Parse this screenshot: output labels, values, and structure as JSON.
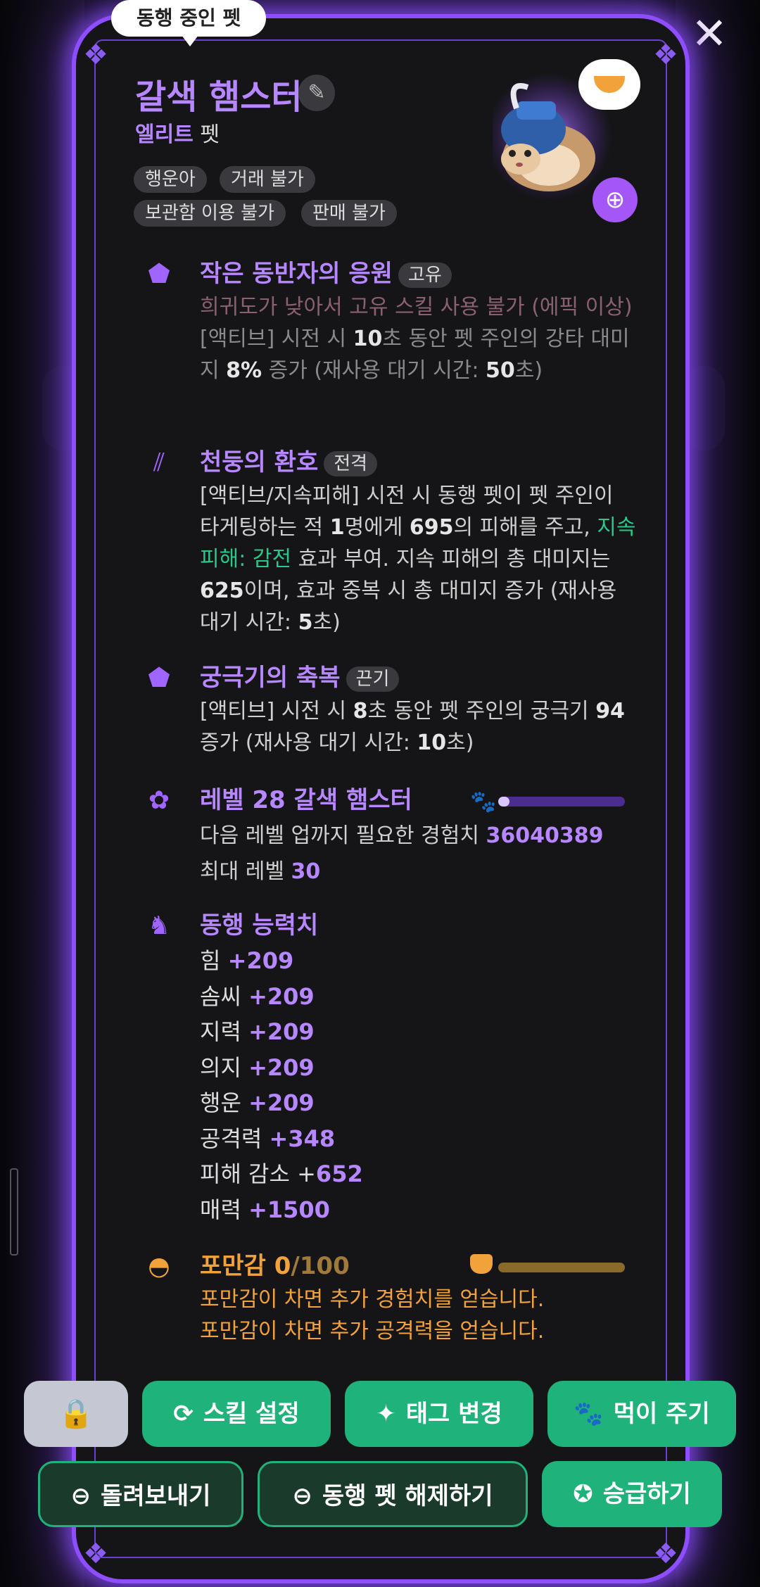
{
  "tooltip": "동행 중인 펫",
  "pet": {
    "name": "갈색 햄스터",
    "grade": "엘리트",
    "grade_suffix": "펫",
    "tags": [
      "행운아",
      "거래 불가",
      "보관함 이용 불가",
      "판매 불가"
    ]
  },
  "skills": [
    {
      "title": "작은 동반자의 응원",
      "badge": "고유",
      "disabled_note": "희귀도가 낮아서 고유 스킬 사용 불가 (에픽 이상)",
      "desc_pre": "[액티브] 시전 시 ",
      "desc_b1": "10",
      "desc_mid1": "초 동안 펫 주인의 강타 대미지 ",
      "desc_b2": "8%",
      "desc_mid2": " 증가 (재사용 대기 시간: ",
      "desc_b3": "50",
      "desc_end": "초)"
    },
    {
      "title": "천둥의 환호",
      "badge": "전격",
      "desc_pre": "[액티브/지속피해] 시전 시 동행 펫이 펫 주인이 타게팅하는 적 ",
      "desc_b1": "1",
      "desc_mid1": "명에게 ",
      "desc_b2": "695",
      "desc_mid2": "의 피해를 주고, ",
      "desc_green": "지속 피해: 감전",
      "desc_mid3": " 효과 부여. 지속 피해의 총 대미지는 ",
      "desc_b3": "625",
      "desc_mid4": "이며, 효과 중복 시 총 대미지 증가 (재사용 대기 시간: ",
      "desc_b4": "5",
      "desc_end": "초)"
    },
    {
      "title": "궁극기의 축복",
      "badge": "끈기",
      "desc_pre": "[액티브] 시전 시 ",
      "desc_b1": "8",
      "desc_mid1": "초 동안 펫 주인의 궁극기 ",
      "desc_b2": "94",
      "desc_mid2": " 증가 (재사용 대기 시간: ",
      "desc_b3": "10",
      "desc_end": "초)"
    }
  ],
  "level": {
    "title": "레벨 28 갈색 햄스터",
    "exp_label": "다음 레벨 업까지 필요한 경험치 ",
    "exp_value": "36040389",
    "max_label": "최대 레벨 ",
    "max_value": "30",
    "progress": 0.04
  },
  "stats": {
    "title": "동행 능력치",
    "items": [
      {
        "label": "힘 ",
        "value": "+209"
      },
      {
        "label": "솜씨 ",
        "value": "+209"
      },
      {
        "label": "지력 ",
        "value": "+209"
      },
      {
        "label": "의지 ",
        "value": "+209"
      },
      {
        "label": "행운 ",
        "value": "+209"
      },
      {
        "label": "공격력 ",
        "value": "+348"
      },
      {
        "label": "피해 감소 +",
        "value": "652"
      },
      {
        "label": "매력 ",
        "value": "+1500"
      }
    ]
  },
  "satiety": {
    "title": "포만감 ",
    "current": "0",
    "max": "/100",
    "line1": "포만감이 차면 추가 경험치를 얻습니다.",
    "line2": "포만감이 차면 추가 공격력을 얻습니다.",
    "progress": 0.0
  },
  "buttons": {
    "skill_settings": "스킬 설정",
    "change_tag": "태그 변경",
    "feed": "먹이 주기",
    "send_back": "돌려보내기",
    "release_companion": "동행 펫 해제하기",
    "promote": "승급하기"
  },
  "colors": {
    "accent": "#b787ff",
    "glow": "#8e4dff",
    "button_green": "#1fb27a",
    "satiety": "#f2a23a",
    "status_green": "#28c98a"
  }
}
